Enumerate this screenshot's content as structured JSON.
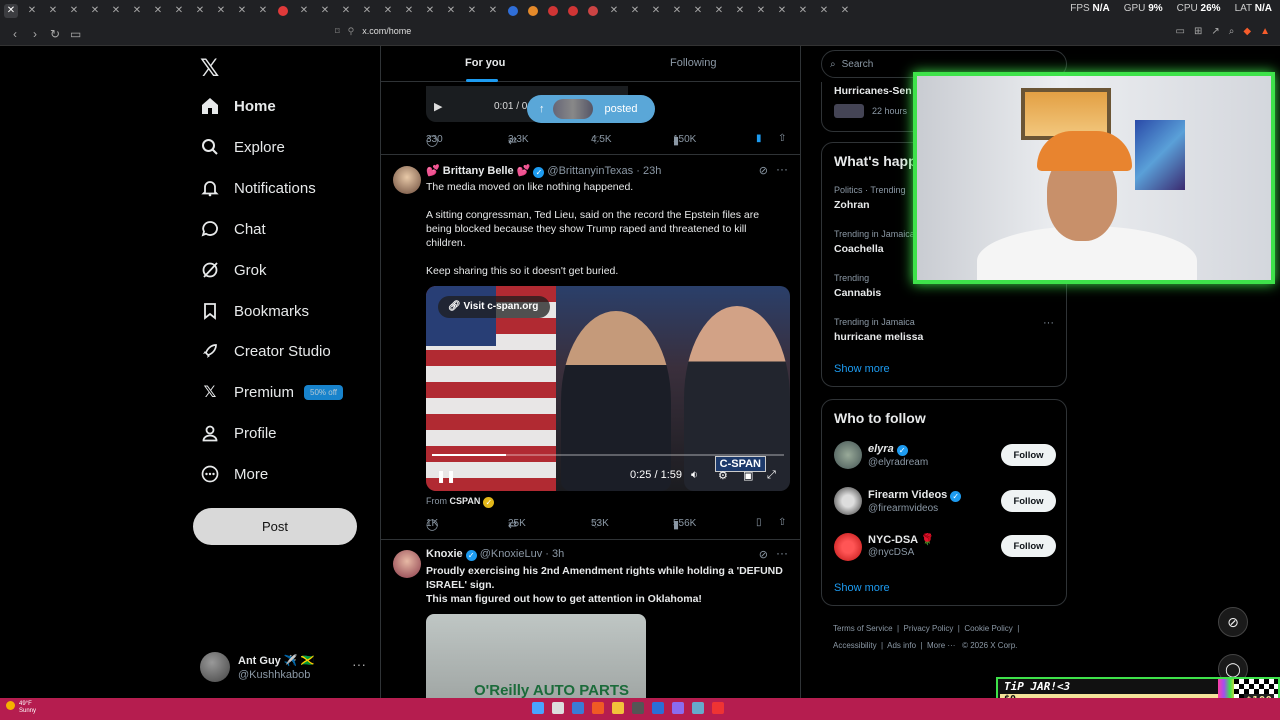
{
  "browser": {
    "url": "x.com/home",
    "perf": {
      "fps_label": "FPS",
      "fps": "N/A",
      "gpu_label": "GPU",
      "gpu": "9%",
      "cpu_label": "CPU",
      "cpu": "26%",
      "lat_label": "LAT",
      "lat": "N/A"
    }
  },
  "nav": {
    "items": [
      {
        "label": "Home",
        "icon": "home-icon"
      },
      {
        "label": "Explore",
        "icon": "search-icon"
      },
      {
        "label": "Notifications",
        "icon": "bell-icon"
      },
      {
        "label": "Chat",
        "icon": "chat-icon"
      },
      {
        "label": "Grok",
        "icon": "grok-icon"
      },
      {
        "label": "Bookmarks",
        "icon": "bookmark-icon"
      },
      {
        "label": "Creator Studio",
        "icon": "rocket-icon"
      },
      {
        "label": "Premium",
        "icon": "x-icon"
      },
      {
        "label": "Profile",
        "icon": "person-icon"
      },
      {
        "label": "More",
        "icon": "more-circle-icon"
      }
    ],
    "premium_badge": "50% off",
    "post_label": "Post",
    "account": {
      "name": "Ant Guy ✈️ 🇯🇲",
      "handle": "@Kushhkabob"
    }
  },
  "feed": {
    "tabs": [
      "For you",
      "Following"
    ],
    "top_post": {
      "video_time": "0:01 / 0",
      "posted_label": "posted",
      "replies": "330",
      "reposts": "3.3K",
      "likes": "4.5K",
      "views": "150K"
    },
    "tweet1": {
      "name": "💕 Brittany Belle 💕",
      "handle": "@BrittanyinTexas",
      "time": "· 23h",
      "text": [
        "The media moved on like nothing happened.",
        "A sitting congressman, Ted Lieu, said on the record the Epstein files are being blocked because they show Trump raped and threatened to kill children.",
        "Keep sharing this so it doesn't get buried."
      ],
      "visit_label": "Visit c-span.org",
      "video_time": "0:25 / 1:59",
      "video_progress": 0.21,
      "watermark": "C-SPAN",
      "from_label": "From",
      "from_source": "CSPAN",
      "replies": "1K",
      "reposts": "25K",
      "likes": "53K",
      "views": "556K"
    },
    "tweet2": {
      "name": "Knoxie",
      "handle": "@KnoxieLuv",
      "time": "· 3h",
      "text": [
        "Proudly exercising his 2nd Amendment rights while holding a 'DEFUND ISRAEL' sign.",
        "This man figured out how to get attention in Oklahoma!"
      ],
      "image_sign": "O'Reilly AUTO PARTS"
    }
  },
  "right": {
    "search_placeholder": "Search",
    "news_top": {
      "title": "Hurricanes-Sen",
      "time": "22 hours"
    },
    "happening_title": "What's happening",
    "trends": [
      {
        "cat": "Politics · Trending",
        "name": "Zohran"
      },
      {
        "cat": "Trending in Jamaica",
        "name": "Coachella"
      },
      {
        "cat": "Trending",
        "name": "Cannabis"
      },
      {
        "cat": "Trending in Jamaica",
        "name": "hurricane melissa"
      }
    ],
    "show_more": "Show more",
    "wtf_title": "Who to follow",
    "follow_label": "Follow",
    "suggestions": [
      {
        "name": "elyra",
        "handle": "@elyradream"
      },
      {
        "name": "Firearm Videos",
        "handle": "@firearmvideos"
      },
      {
        "name": "NYC-DSA 🌹",
        "handle": "@nycDSA"
      }
    ],
    "footer": [
      "Terms of Service",
      "Privacy Policy",
      "Cookie Policy",
      "Accessibility",
      "Ads info",
      "More ···",
      "© 2026 X Corp."
    ]
  },
  "overlay": {
    "tip_title": "TiP JAR!<3",
    "tip_amount": "$0",
    "tip_goal": "$100"
  },
  "taskbar": {
    "temp": "49°F",
    "weather": "Sunny"
  }
}
